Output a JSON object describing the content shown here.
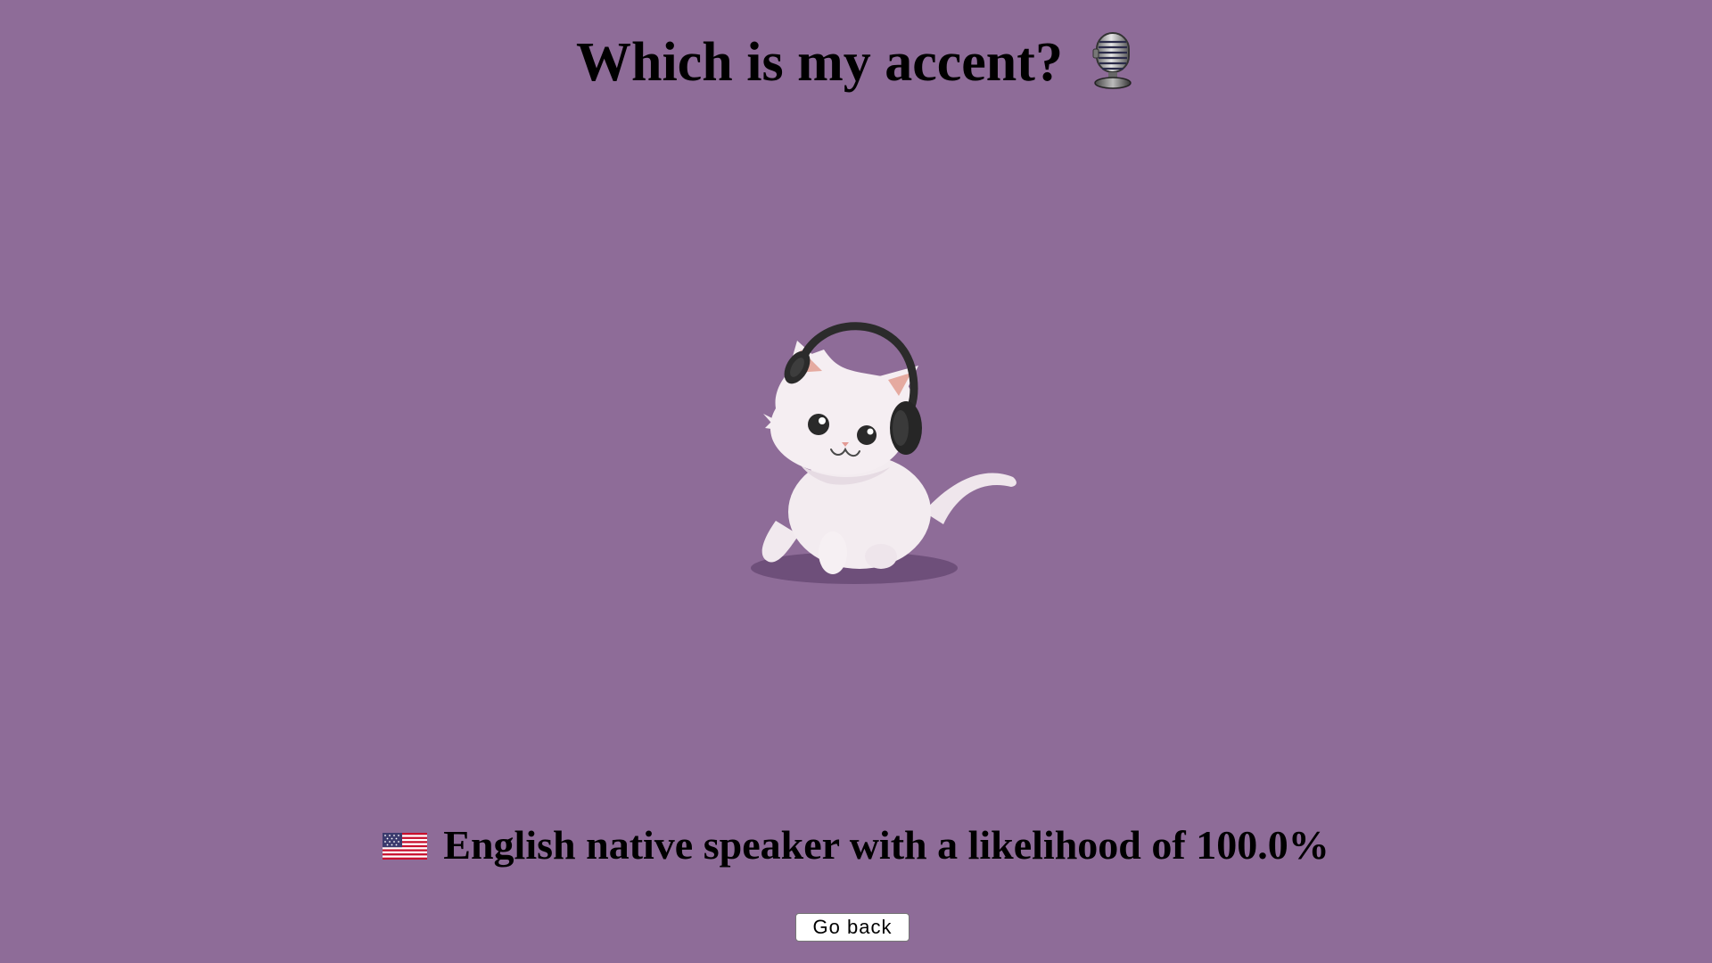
{
  "header": {
    "title": "Which is my accent?",
    "title_icon": "microphone-icon"
  },
  "illustration": {
    "icon": "cat-with-headphones-icon"
  },
  "result": {
    "flag_icon": "us-flag-icon",
    "text": "English native speaker with a likelihood of 100.0%"
  },
  "actions": {
    "go_back_label": "Go back"
  },
  "colors": {
    "background": "#8e6c98",
    "text": "#000000",
    "button_background": "#ffffff"
  }
}
